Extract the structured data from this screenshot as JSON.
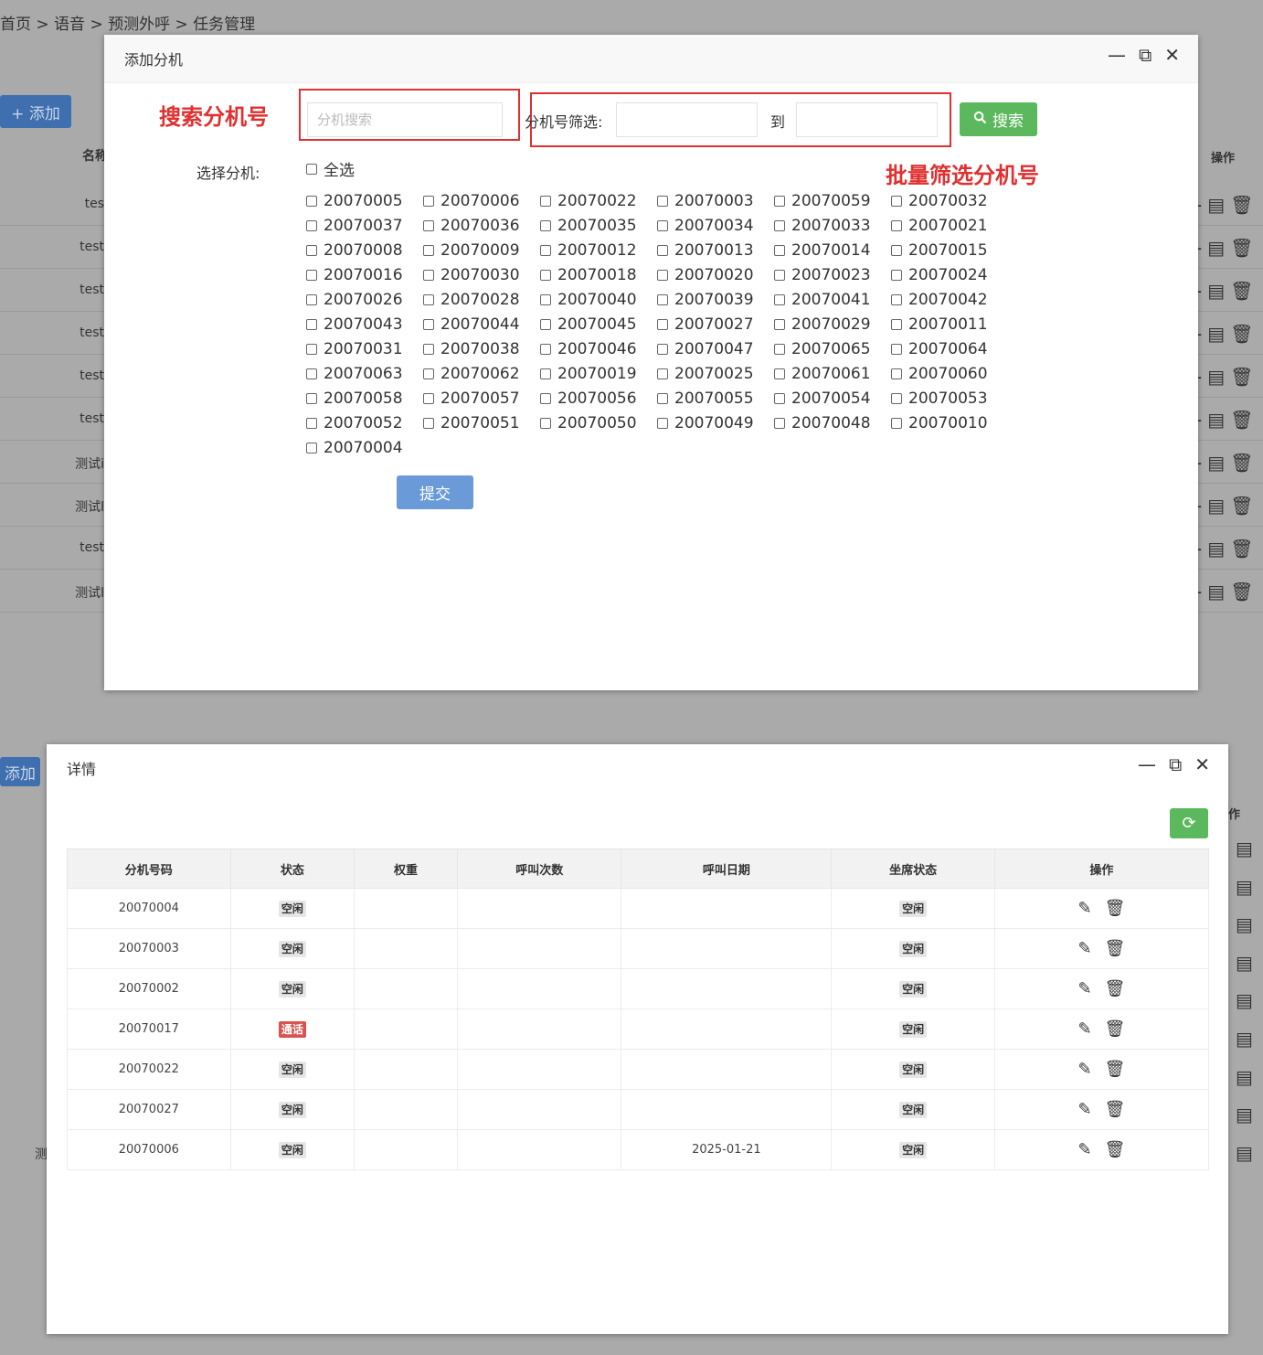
{
  "breadcrumb": "首页 > 语音 > 预测外呼 > 任务管理",
  "background": {
    "add_label": "+ 添加",
    "add_label_2": "添加",
    "header_name": "名称",
    "header_op": "操作",
    "header_op_2": "作",
    "rows": [
      "tes",
      "test",
      "test",
      "test",
      "test",
      "test",
      "测试i",
      "测试l",
      "test",
      "测试l"
    ],
    "lower_row": "测"
  },
  "add_modal": {
    "title": "添加分机",
    "search_placeholder": "分机搜索",
    "filter_label": "分机号筛选:",
    "to_label": "到",
    "search_btn": "搜索",
    "select_label": "选择分机:",
    "select_all": "全选",
    "extensions": [
      "20070005",
      "20070006",
      "20070022",
      "20070003",
      "20070059",
      "20070032",
      "20070037",
      "20070036",
      "20070035",
      "20070034",
      "20070033",
      "20070021",
      "20070008",
      "20070009",
      "20070012",
      "20070013",
      "20070014",
      "20070015",
      "20070016",
      "20070030",
      "20070018",
      "20070020",
      "20070023",
      "20070024",
      "20070026",
      "20070028",
      "20070040",
      "20070039",
      "20070041",
      "20070042",
      "20070043",
      "20070044",
      "20070045",
      "20070027",
      "20070029",
      "20070011",
      "20070031",
      "20070038",
      "20070046",
      "20070047",
      "20070065",
      "20070064",
      "20070063",
      "20070062",
      "20070019",
      "20070025",
      "20070061",
      "20070060",
      "20070058",
      "20070057",
      "20070056",
      "20070055",
      "20070054",
      "20070053",
      "20070052",
      "20070051",
      "20070050",
      "20070049",
      "20070048",
      "20070010",
      "20070004"
    ],
    "submit": "提交",
    "annotation_search": "搜索分机号",
    "annotation_filter": "批量筛选分机号",
    "annotation_color": "#e03030"
  },
  "detail_modal": {
    "title": "详情",
    "columns": [
      "分机号码",
      "状态",
      "权重",
      "呼叫次数",
      "呼叫日期",
      "坐席状态",
      "操作"
    ],
    "rows": [
      {
        "ext": "20070004",
        "status": "空闲",
        "status_color": "gray",
        "weight": "",
        "calls": "",
        "date": "",
        "agent": "空闲"
      },
      {
        "ext": "20070003",
        "status": "空闲",
        "status_color": "gray",
        "weight": "",
        "calls": "",
        "date": "",
        "agent": "空闲"
      },
      {
        "ext": "20070002",
        "status": "空闲",
        "status_color": "gray",
        "weight": "",
        "calls": "",
        "date": "",
        "agent": "空闲"
      },
      {
        "ext": "20070017",
        "status": "通话",
        "status_color": "red",
        "weight": "",
        "calls": "",
        "date": "",
        "agent": "空闲"
      },
      {
        "ext": "20070022",
        "status": "空闲",
        "status_color": "gray",
        "weight": "",
        "calls": "",
        "date": "",
        "agent": "空闲"
      },
      {
        "ext": "20070027",
        "status": "空闲",
        "status_color": "gray",
        "weight": "",
        "calls": "",
        "date": "",
        "agent": "空闲"
      },
      {
        "ext": "20070006",
        "status": "空闲",
        "status_color": "gray",
        "weight": "",
        "calls": "",
        "date": "2025-01-21",
        "agent": "空闲"
      }
    ]
  },
  "icons": {
    "minimize": "minimize-icon",
    "maximize": "maximize-icon",
    "close": "close-icon",
    "search": "search-icon",
    "refresh": "refresh-icon",
    "edit": "pencil-icon",
    "delete": "trash-icon",
    "copy": "copy-icon"
  },
  "colors": {
    "primary_green": "#5cb85c",
    "submit_blue": "#6a9ad8",
    "busy_red": "#d9534f",
    "annotation_red": "#e03030"
  }
}
